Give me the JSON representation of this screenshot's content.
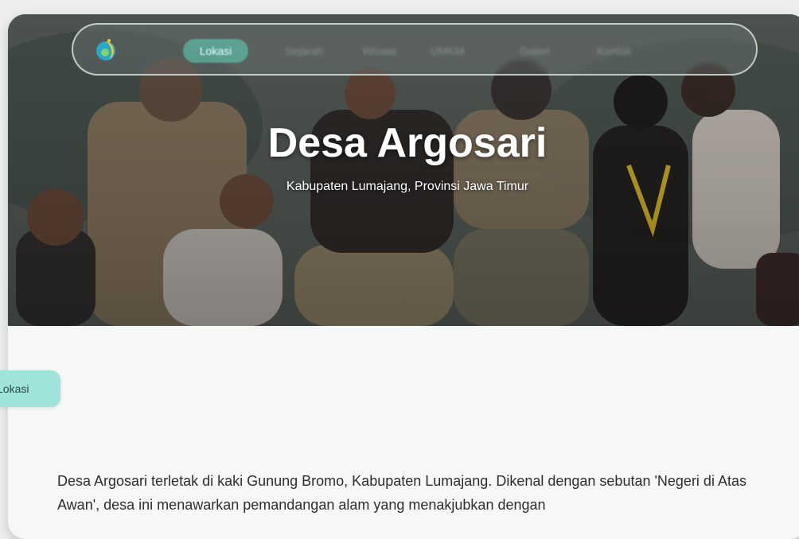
{
  "nav": {
    "items": [
      {
        "label": "Lokasi",
        "active": true
      },
      {
        "label": "Sejarah",
        "active": false
      },
      {
        "label": "Wisata",
        "active": false
      },
      {
        "label": "UMKM",
        "active": false
      },
      {
        "label": "Galeri",
        "active": false
      },
      {
        "label": "Kontak",
        "active": false
      }
    ],
    "logo_icon": "village-logo-icon"
  },
  "hero": {
    "title": "Desa Argosari",
    "subtitle": "Kabupaten Lumajang, Provinsi Jawa Timur"
  },
  "side_tab": {
    "label": "Lokasi"
  },
  "content": {
    "paragraph": "Desa Argosari terletak di kaki Gunung Bromo, Kabupaten Lumajang. Dikenal dengan sebutan 'Negeri di Atas Awan', desa ini menawarkan pemandangan alam yang menakjubkan dengan"
  },
  "colors": {
    "accent": "#5ed6be",
    "side_tab": "#9fe3da",
    "text": "#2b2f2e"
  }
}
